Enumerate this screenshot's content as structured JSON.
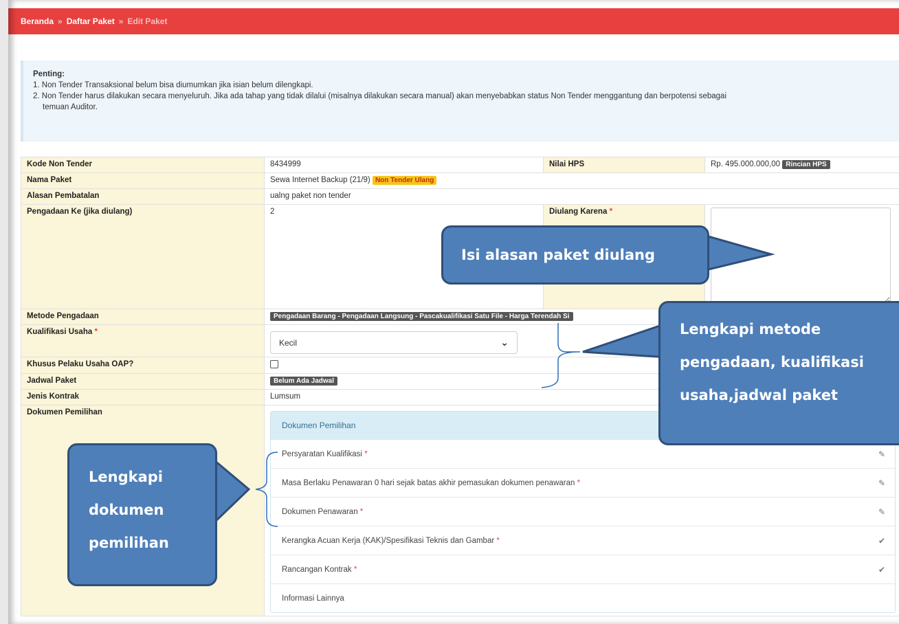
{
  "breadcrumb": {
    "home": "Beranda",
    "list": "Daftar Paket",
    "current": "Edit Paket",
    "separator": "»"
  },
  "notice": {
    "title": "Penting:",
    "line1": "1. Non Tender Transaksional belum bisa diumumkan jika isian belum dilengkapi.",
    "line2": "2. Non Tender harus dilakukan secara menyeluruh. Jika ada tahap yang tidak dilalui (misalnya dilakukan secara manual) akan menyebabkan status Non Tender menggantung dan berpotensi sebagai",
    "line2b": "temuan Auditor."
  },
  "form": {
    "kode_label": "Kode Non Tender",
    "kode_value": "8434999",
    "hps_label": "Nilai HPS",
    "hps_value": "Rp. 495.000.000,00",
    "hps_button": "Rincian HPS",
    "nama_label": "Nama Paket",
    "nama_value": "Sewa Internet Backup (21/9)",
    "nama_badge": "Non Tender Ulang",
    "alasan_label": "Alasan Pembatalan",
    "alasan_value": "ualng paket non tender",
    "pengadaan_ke_label": "Pengadaan Ke (jika diulang)",
    "pengadaan_ke_value": "2",
    "diulang_label": "Diulang Karena",
    "required_mark": "*",
    "metode_label": "Metode Pengadaan",
    "metode_value": "Pengadaan Barang - Pengadaan Langsung - Pascakualifikasi Satu File - Harga Terendah Si",
    "kualifikasi_label": "Kualifikasi Usaha",
    "kualifikasi_value": "Kecil",
    "oap_label": "Khusus Pelaku Usaha OAP?",
    "jadwal_label": "Jadwal Paket",
    "jadwal_value": "Belum Ada Jadwal",
    "kontrak_label": "Jenis Kontrak",
    "kontrak_value": "Lumsum",
    "dokumen_label": "Dokumen Pemilihan"
  },
  "doc_panel": {
    "header": "Dokumen Pemilihan",
    "items": [
      {
        "label": "Persyaratan Kualifikasi",
        "required": true,
        "icon": "edit-icon"
      },
      {
        "label": "Masa Berlaku Penawaran 0 hari sejak batas akhir pemasukan dokumen penawaran",
        "required": true,
        "icon": "edit-icon"
      },
      {
        "label": "Dokumen Penawaran",
        "required": true,
        "icon": "edit-icon"
      },
      {
        "label": "Kerangka Acuan Kerja (KAK)/Spesifikasi Teknis dan Gambar",
        "required": true,
        "icon": "check-icon"
      },
      {
        "label": "Rancangan Kontrak",
        "required": true,
        "icon": "check-icon"
      },
      {
        "label": "Informasi Lainnya",
        "required": false,
        "icon": ""
      }
    ]
  },
  "callouts": {
    "diulang": "Isi alasan paket diulang",
    "metode_line1": "Lengkapi metode",
    "metode_line2": "pengadaan, kualifikasi",
    "metode_line3": "usaha,jadwal paket",
    "dokumen_line1": "Lengkapi",
    "dokumen_line2": "dokumen",
    "dokumen_line3": "pemilihan"
  },
  "colors": {
    "breadcrumb_bar": "#e8403f",
    "label_cell": "#fbf5d9",
    "callout_fill": "#4f7fb9",
    "callout_border": "#2f4f78"
  }
}
